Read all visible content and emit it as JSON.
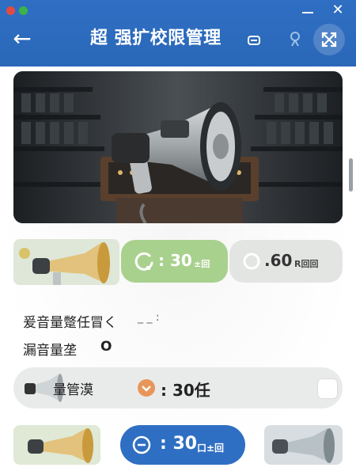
{
  "window": {
    "close_glyph": "✕"
  },
  "header": {
    "back_glyph": "←",
    "title": "超 强扩校限管理"
  },
  "presets": [
    {
      "label": ": 30",
      "suffix": "±回"
    },
    {
      "label": ".60",
      "suffix": "R回回"
    }
  ],
  "settings": {
    "row1_label": "爰音量蹩任冒く",
    "row1_dots": "_ _ :",
    "row2_label": "漏音量垄",
    "row2_glyph": "O",
    "row3_label": "量管漠",
    "row3_value": ": 30任"
  },
  "bottom": {
    "main_label": ": 30",
    "main_suffix": "口±回"
  },
  "colors": {
    "header": "#2f6fc3",
    "green_pill": "#a9d18e",
    "grey_pill": "#e3e5e3",
    "blue_pill": "#2f6fc3",
    "orange": "#e8955a"
  }
}
